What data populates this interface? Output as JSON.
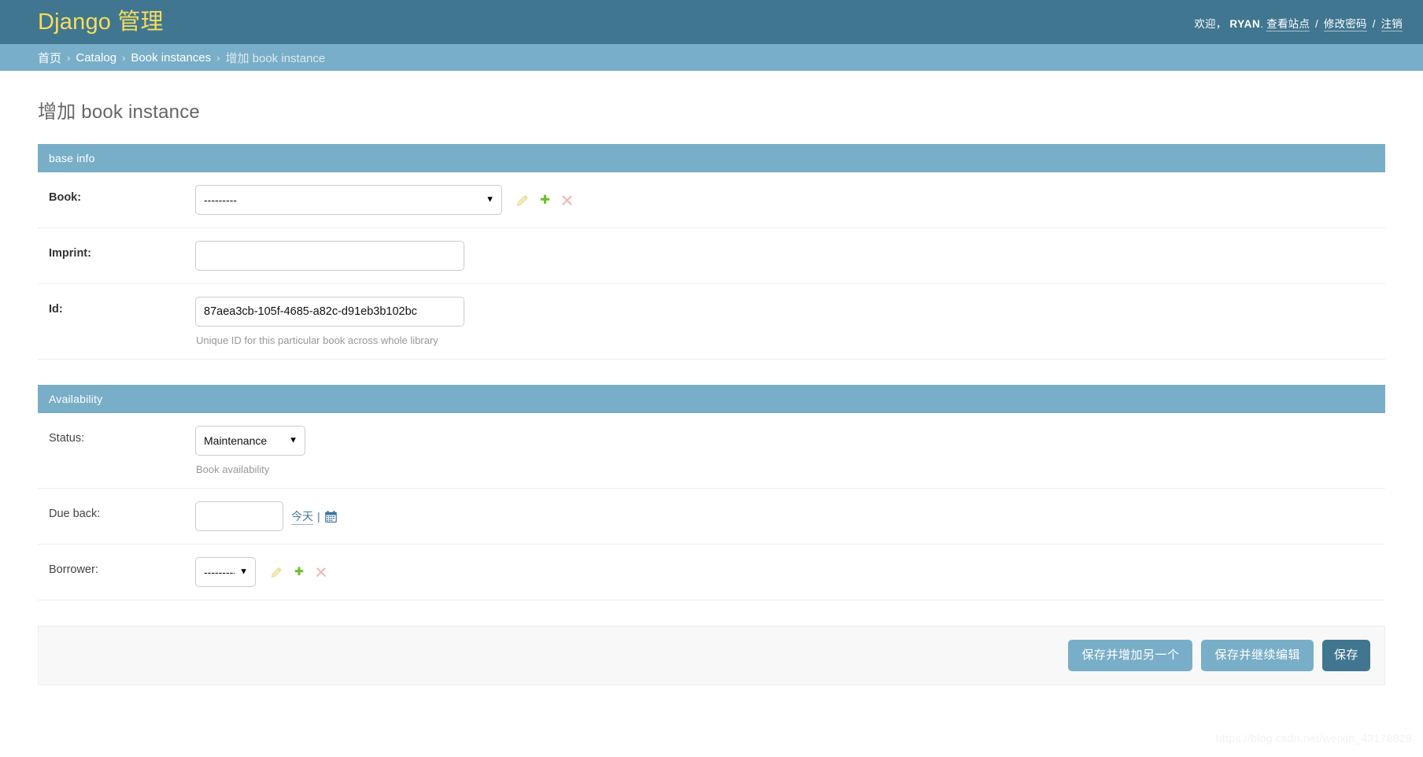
{
  "header": {
    "site_name": "Django 管理",
    "user_tools": {
      "welcome": "欢迎，",
      "username": "RYAN",
      "after_username": ".",
      "view_site": "查看站点",
      "sep1": "/",
      "change_password": "修改密码",
      "sep2": "/",
      "logout": "注销"
    }
  },
  "breadcrumbs": {
    "items": [
      {
        "label": "首页",
        "link": true
      },
      {
        "label": "Catalog",
        "link": true
      },
      {
        "label": "Book instances",
        "link": true
      },
      {
        "label": "增加 book instance",
        "link": false
      }
    ],
    "separator": "›"
  },
  "page": {
    "title": "增加 book instance"
  },
  "fieldsets": [
    {
      "legend": "base info",
      "rows": [
        {
          "label": "Book:",
          "bold": true,
          "widget": "select",
          "value": "---------",
          "options": [
            "---------"
          ],
          "related_icons": [
            "pencil-icon",
            "plus-icon",
            "cross-icon"
          ],
          "help": ""
        },
        {
          "label": "Imprint:",
          "bold": true,
          "widget": "text",
          "value": "",
          "placeholder": "",
          "help": ""
        },
        {
          "label": "Id:",
          "bold": true,
          "widget": "text",
          "value": "87aea3cb-105f-4685-a82c-d91eb3b102bc",
          "placeholder": "",
          "help": "Unique ID for this particular book across whole library"
        }
      ]
    },
    {
      "legend": "Availability",
      "rows": [
        {
          "label": "Status:",
          "bold": false,
          "widget": "select",
          "value": "Maintenance",
          "options": [
            "Maintenance"
          ],
          "help": "Book availability"
        },
        {
          "label": "Due back:",
          "bold": false,
          "widget": "date",
          "value": "",
          "today_label": "今天",
          "pipe": "|",
          "calendar_icon": "calendar-icon",
          "help": ""
        },
        {
          "label": "Borrower:",
          "bold": false,
          "widget": "select",
          "value": "---------",
          "options": [
            "---------"
          ],
          "related_icons": [
            "pencil-icon",
            "plus-icon",
            "cross-icon"
          ],
          "help": ""
        }
      ]
    }
  ],
  "submit_row": {
    "save_and_add_another": "保存并增加另一个",
    "save_and_continue": "保存并继续编辑",
    "save": "保存"
  },
  "watermark": "https://blog.csdn.net/weixin_43178828",
  "colors": {
    "header_bg": "#417690",
    "breadcrumb_bg": "#79aec8",
    "fieldset_bg": "#79aec8",
    "logo_text": "#f5dd5d",
    "button_secondary": "#79aec8",
    "button_default": "#417690",
    "link": "#447e9b"
  }
}
